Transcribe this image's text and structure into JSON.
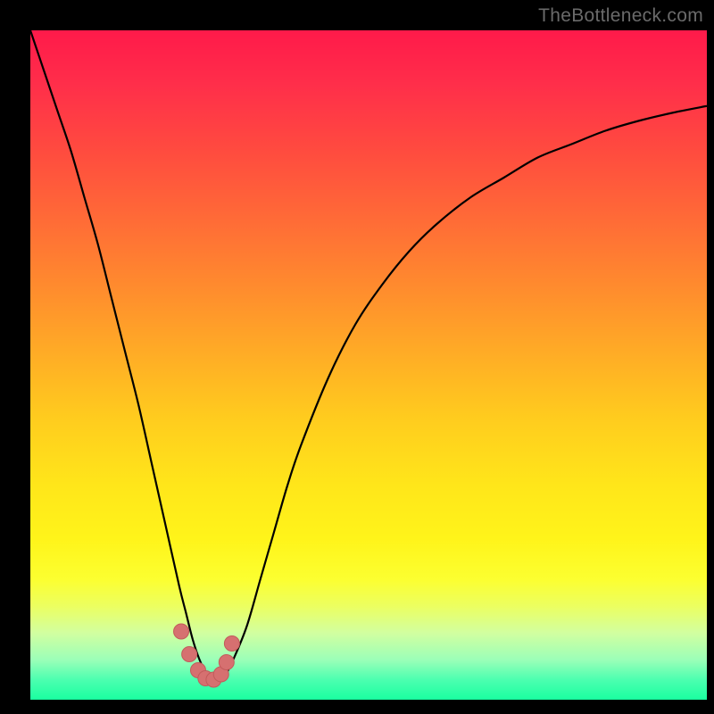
{
  "watermark": "TheBottleneck.com",
  "chart_data": {
    "type": "line",
    "title": "",
    "xlabel": "",
    "ylabel": "",
    "xlim": [
      0,
      100
    ],
    "ylim": [
      0,
      100
    ],
    "series": [
      {
        "name": "curve",
        "x": [
          0,
          2,
          4,
          6,
          8,
          10,
          12,
          14,
          16,
          18,
          20,
          22,
          23,
          24,
          25,
          26,
          27,
          28,
          29,
          30,
          32,
          34,
          36,
          38,
          40,
          44,
          48,
          52,
          56,
          60,
          65,
          70,
          75,
          80,
          85,
          90,
          95,
          100
        ],
        "y": [
          100,
          94,
          88,
          82,
          75,
          68,
          60,
          52,
          44,
          35,
          26,
          17,
          13,
          9,
          6,
          4,
          3,
          3,
          4,
          6,
          11,
          18,
          25,
          32,
          38,
          48,
          56,
          62,
          67,
          71,
          75,
          78,
          81,
          83,
          85,
          86.5,
          87.7,
          88.7
        ]
      }
    ],
    "markers": {
      "x": [
        22.3,
        23.5,
        24.8,
        25.9,
        27.1,
        28.2,
        29.0,
        29.8
      ],
      "y": [
        10.2,
        6.8,
        4.4,
        3.2,
        3.0,
        3.8,
        5.6,
        8.4
      ]
    },
    "gradient_bands": [
      {
        "pos": 0.0,
        "color": "#ff1a4a"
      },
      {
        "pos": 0.5,
        "color": "#ffcc1e"
      },
      {
        "pos": 0.82,
        "color": "#fcff30"
      },
      {
        "pos": 1.0,
        "color": "#1affa0"
      }
    ]
  }
}
